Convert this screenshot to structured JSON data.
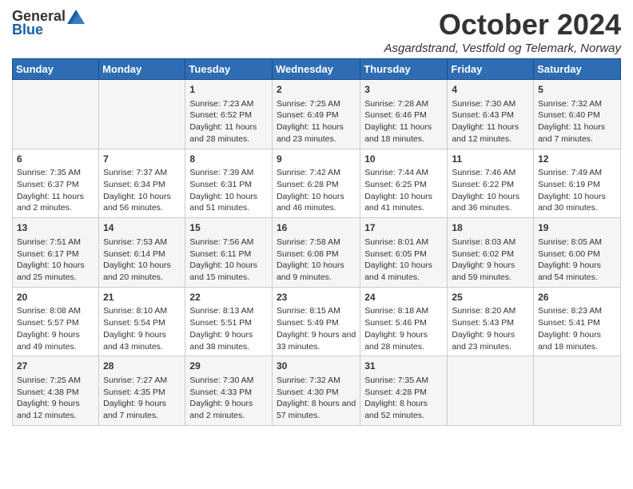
{
  "logo": {
    "general": "General",
    "blue": "Blue"
  },
  "title": "October 2024",
  "location": "Asgardstrand, Vestfold og Telemark, Norway",
  "days_of_week": [
    "Sunday",
    "Monday",
    "Tuesday",
    "Wednesday",
    "Thursday",
    "Friday",
    "Saturday"
  ],
  "weeks": [
    [
      {
        "day": "",
        "content": ""
      },
      {
        "day": "",
        "content": ""
      },
      {
        "day": "1",
        "content": "Sunrise: 7:23 AM\nSunset: 6:52 PM\nDaylight: 11 hours and 28 minutes."
      },
      {
        "day": "2",
        "content": "Sunrise: 7:25 AM\nSunset: 6:49 PM\nDaylight: 11 hours and 23 minutes."
      },
      {
        "day": "3",
        "content": "Sunrise: 7:28 AM\nSunset: 6:46 PM\nDaylight: 11 hours and 18 minutes."
      },
      {
        "day": "4",
        "content": "Sunrise: 7:30 AM\nSunset: 6:43 PM\nDaylight: 11 hours and 12 minutes."
      },
      {
        "day": "5",
        "content": "Sunrise: 7:32 AM\nSunset: 6:40 PM\nDaylight: 11 hours and 7 minutes."
      }
    ],
    [
      {
        "day": "6",
        "content": "Sunrise: 7:35 AM\nSunset: 6:37 PM\nDaylight: 11 hours and 2 minutes."
      },
      {
        "day": "7",
        "content": "Sunrise: 7:37 AM\nSunset: 6:34 PM\nDaylight: 10 hours and 56 minutes."
      },
      {
        "day": "8",
        "content": "Sunrise: 7:39 AM\nSunset: 6:31 PM\nDaylight: 10 hours and 51 minutes."
      },
      {
        "day": "9",
        "content": "Sunrise: 7:42 AM\nSunset: 6:28 PM\nDaylight: 10 hours and 46 minutes."
      },
      {
        "day": "10",
        "content": "Sunrise: 7:44 AM\nSunset: 6:25 PM\nDaylight: 10 hours and 41 minutes."
      },
      {
        "day": "11",
        "content": "Sunrise: 7:46 AM\nSunset: 6:22 PM\nDaylight: 10 hours and 36 minutes."
      },
      {
        "day": "12",
        "content": "Sunrise: 7:49 AM\nSunset: 6:19 PM\nDaylight: 10 hours and 30 minutes."
      }
    ],
    [
      {
        "day": "13",
        "content": "Sunrise: 7:51 AM\nSunset: 6:17 PM\nDaylight: 10 hours and 25 minutes."
      },
      {
        "day": "14",
        "content": "Sunrise: 7:53 AM\nSunset: 6:14 PM\nDaylight: 10 hours and 20 minutes."
      },
      {
        "day": "15",
        "content": "Sunrise: 7:56 AM\nSunset: 6:11 PM\nDaylight: 10 hours and 15 minutes."
      },
      {
        "day": "16",
        "content": "Sunrise: 7:58 AM\nSunset: 6:08 PM\nDaylight: 10 hours and 9 minutes."
      },
      {
        "day": "17",
        "content": "Sunrise: 8:01 AM\nSunset: 6:05 PM\nDaylight: 10 hours and 4 minutes."
      },
      {
        "day": "18",
        "content": "Sunrise: 8:03 AM\nSunset: 6:02 PM\nDaylight: 9 hours and 59 minutes."
      },
      {
        "day": "19",
        "content": "Sunrise: 8:05 AM\nSunset: 6:00 PM\nDaylight: 9 hours and 54 minutes."
      }
    ],
    [
      {
        "day": "20",
        "content": "Sunrise: 8:08 AM\nSunset: 5:57 PM\nDaylight: 9 hours and 49 minutes."
      },
      {
        "day": "21",
        "content": "Sunrise: 8:10 AM\nSunset: 5:54 PM\nDaylight: 9 hours and 43 minutes."
      },
      {
        "day": "22",
        "content": "Sunrise: 8:13 AM\nSunset: 5:51 PM\nDaylight: 9 hours and 38 minutes."
      },
      {
        "day": "23",
        "content": "Sunrise: 8:15 AM\nSunset: 5:49 PM\nDaylight: 9 hours and 33 minutes."
      },
      {
        "day": "24",
        "content": "Sunrise: 8:18 AM\nSunset: 5:46 PM\nDaylight: 9 hours and 28 minutes."
      },
      {
        "day": "25",
        "content": "Sunrise: 8:20 AM\nSunset: 5:43 PM\nDaylight: 9 hours and 23 minutes."
      },
      {
        "day": "26",
        "content": "Sunrise: 8:23 AM\nSunset: 5:41 PM\nDaylight: 9 hours and 18 minutes."
      }
    ],
    [
      {
        "day": "27",
        "content": "Sunrise: 7:25 AM\nSunset: 4:38 PM\nDaylight: 9 hours and 12 minutes."
      },
      {
        "day": "28",
        "content": "Sunrise: 7:27 AM\nSunset: 4:35 PM\nDaylight: 9 hours and 7 minutes."
      },
      {
        "day": "29",
        "content": "Sunrise: 7:30 AM\nSunset: 4:33 PM\nDaylight: 9 hours and 2 minutes."
      },
      {
        "day": "30",
        "content": "Sunrise: 7:32 AM\nSunset: 4:30 PM\nDaylight: 8 hours and 57 minutes."
      },
      {
        "day": "31",
        "content": "Sunrise: 7:35 AM\nSunset: 4:28 PM\nDaylight: 8 hours and 52 minutes."
      },
      {
        "day": "",
        "content": ""
      },
      {
        "day": "",
        "content": ""
      }
    ]
  ]
}
